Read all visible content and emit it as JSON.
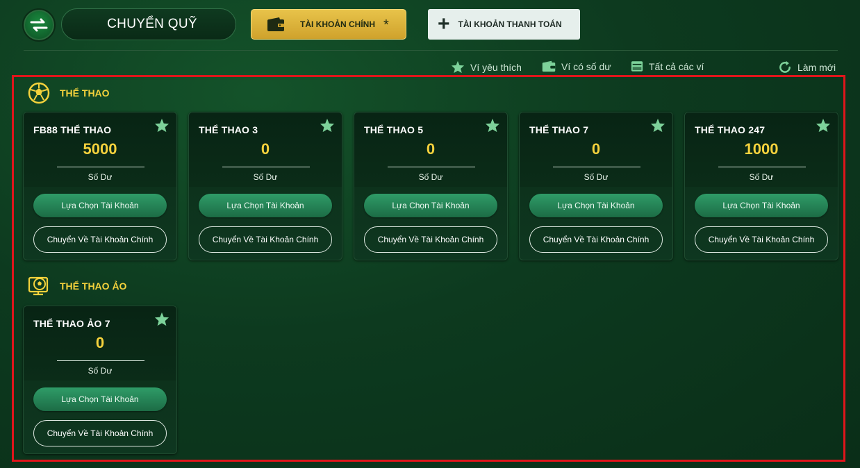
{
  "header": {
    "transfer_title": "CHUYỂN QUỸ",
    "main_account_label": "TÀI KHOẢN CHÍNH",
    "main_account_marker": "*",
    "payment_account_label": "TÀI KHOẢN THANH TOÁN"
  },
  "filters": {
    "favorite": "Ví yêu thích",
    "has_balance": "Ví có số dư",
    "all": "Tất cả các ví",
    "refresh": "Làm mới"
  },
  "sections": [
    {
      "title": "THỂ THAO",
      "icon": "soccer-ball-icon",
      "cards": [
        {
          "name": "FB88 THỂ THAO",
          "balance": "5000",
          "balance_label": "Số Dư",
          "select_label": "Lựa Chọn Tài Khoản",
          "return_label": "Chuyển Về Tài Khoản Chính"
        },
        {
          "name": "THỂ THAO 3",
          "balance": "0",
          "balance_label": "Số Dư",
          "select_label": "Lựa Chọn Tài Khoản",
          "return_label": "Chuyển Về Tài Khoản Chính"
        },
        {
          "name": "THỂ THAO 5",
          "balance": "0",
          "balance_label": "Số Dư",
          "select_label": "Lựa Chọn Tài Khoản",
          "return_label": "Chuyển Về Tài Khoản Chính"
        },
        {
          "name": "THỂ THAO 7",
          "balance": "0",
          "balance_label": "Số Dư",
          "select_label": "Lựa Chọn Tài Khoản",
          "return_label": "Chuyển Về Tài Khoản Chính"
        },
        {
          "name": "THỂ THAO 247",
          "balance": "1000",
          "balance_label": "Số Dư",
          "select_label": "Lựa Chọn Tài Khoản",
          "return_label": "Chuyển Về Tài Khoản Chính"
        }
      ]
    },
    {
      "title": "THỂ THAO ẢO",
      "icon": "virtual-soccer-icon",
      "cards": [
        {
          "name": "THỂ THAO ẢO 7",
          "balance": "0",
          "balance_label": "Số Dư",
          "select_label": "Lựa Chọn Tài Khoản",
          "return_label": "Chuyển Về Tài Khoản Chính"
        }
      ]
    }
  ],
  "colors": {
    "accent_gold": "#f6d23d",
    "button_green": "#2f9c68",
    "highlight_red": "#e0151b",
    "star_green": "#7dd29a"
  }
}
